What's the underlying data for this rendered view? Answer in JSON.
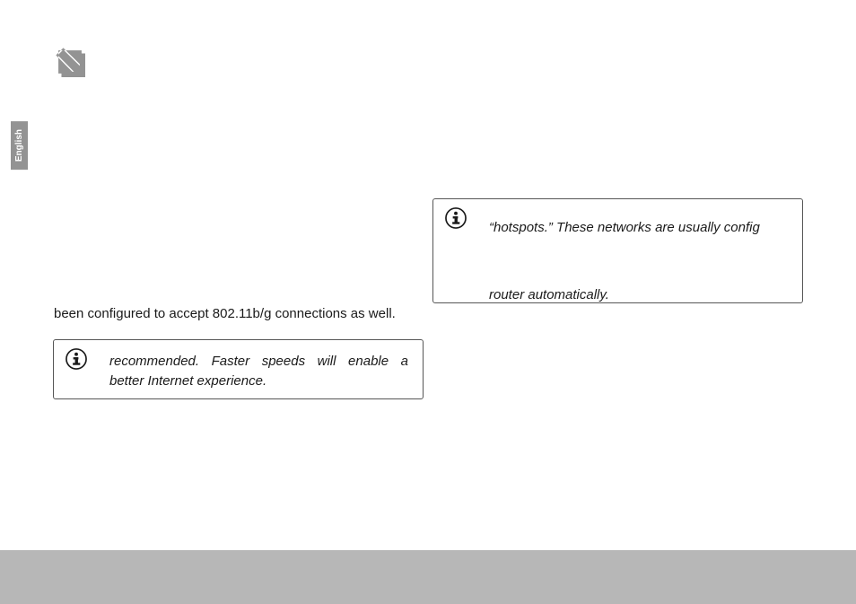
{
  "lang_tab": "English",
  "body_line": "been configured to accept 802.11b/g connections as well.",
  "left_box_line1": "recommended.  Faster  speeds  will  enable  a",
  "left_box_line2": "better Internet experience.",
  "right_box_line1": "“hotspots.” These networks are usually config",
  "right_box_line2": "router automatically."
}
